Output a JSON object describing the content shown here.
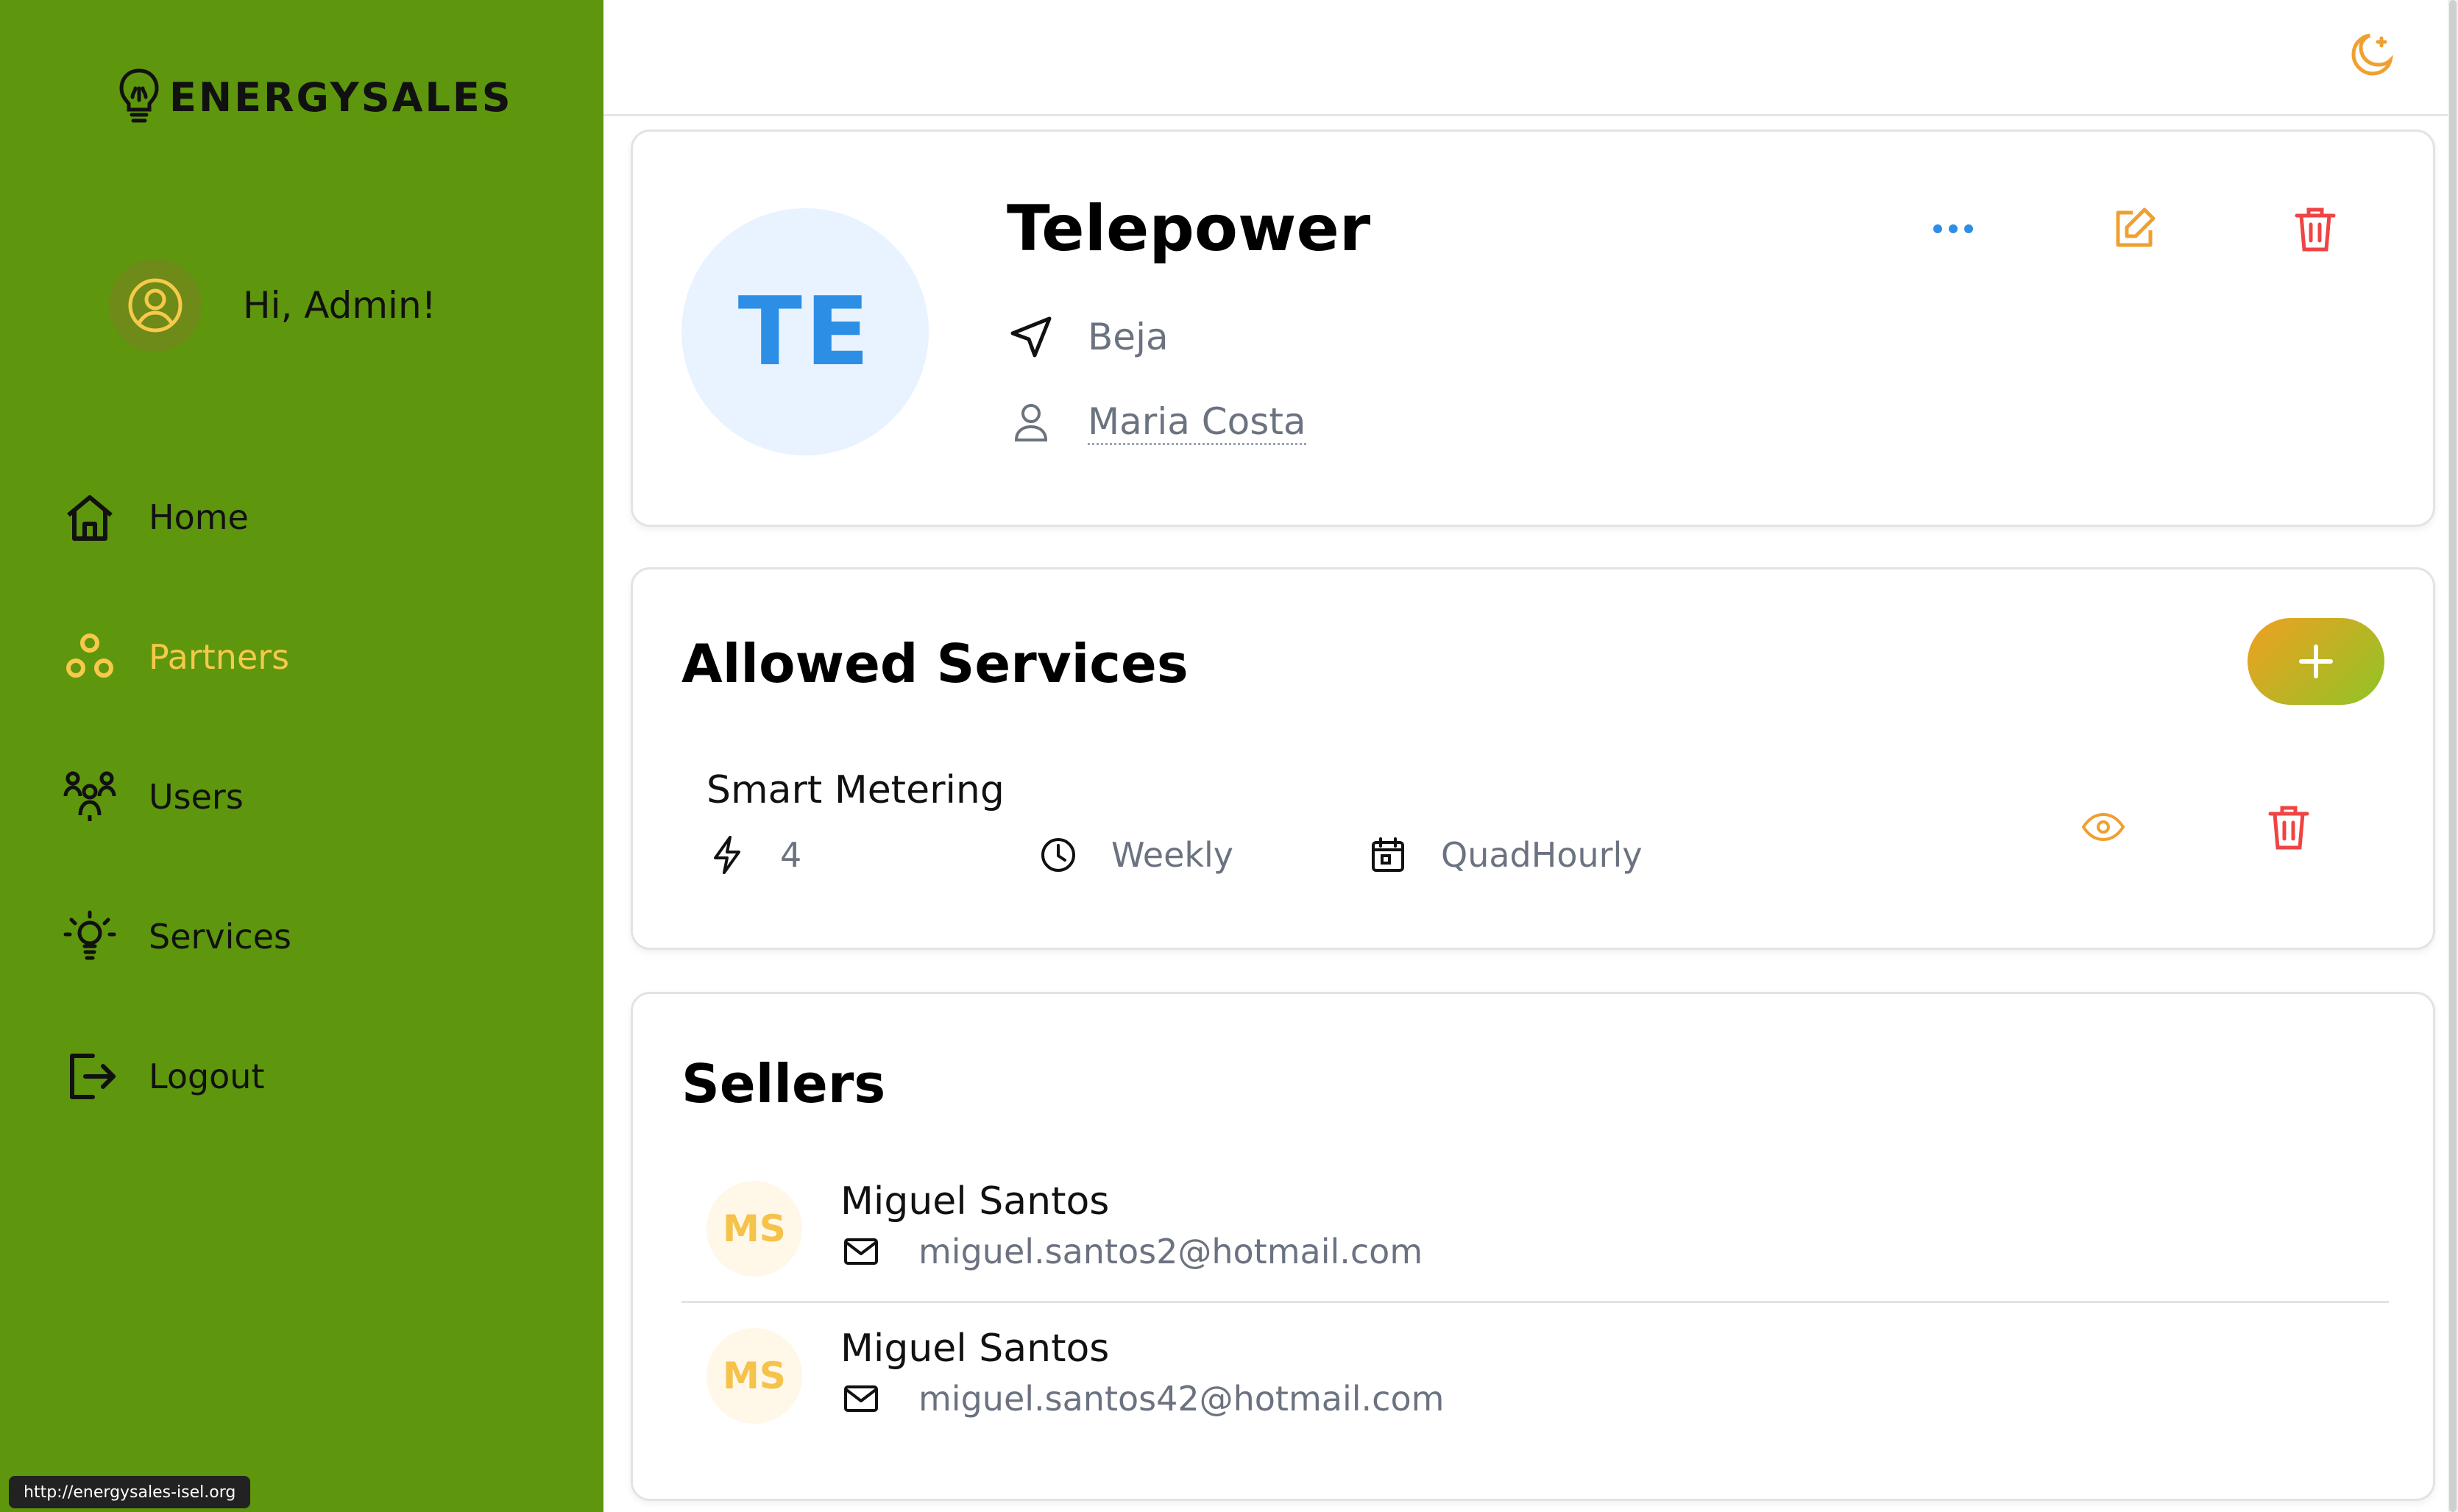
{
  "app": {
    "brand": "ENERGYSALES",
    "status_url": "http://energysales-isel.org"
  },
  "colors": {
    "sidebar_bg": "#5e960d",
    "active_nav": "#f7c94a",
    "accent_blue": "#2d8ee6",
    "edit_orange": "#f0a030",
    "delete_red": "#ef4444"
  },
  "sidebar": {
    "greeting": "Hi, Admin!",
    "items": [
      {
        "label": "Home",
        "icon": "home-icon",
        "active": false
      },
      {
        "label": "Partners",
        "icon": "partners-icon",
        "active": true
      },
      {
        "label": "Users",
        "icon": "users-icon",
        "active": false
      },
      {
        "label": "Services",
        "icon": "lightbulb-icon",
        "active": false
      },
      {
        "label": "Logout",
        "icon": "logout-icon",
        "active": false
      }
    ]
  },
  "topbar": {
    "theme_icon": "moon-icon"
  },
  "partner": {
    "initials": "TE",
    "name": "Telepower",
    "location": "Beja",
    "manager": "Maria Costa",
    "actions": [
      "more-icon",
      "edit-icon",
      "trash-icon"
    ]
  },
  "services": {
    "title": "Allowed Services",
    "items": [
      {
        "name": "Smart Metering",
        "power": "4",
        "frequency": "Weekly",
        "granularity": "QuadHourly"
      }
    ]
  },
  "sellers": {
    "title": "Sellers",
    "items": [
      {
        "initials": "MS",
        "name": "Miguel Santos",
        "email": "miguel.santos2@hotmail.com"
      },
      {
        "initials": "MS",
        "name": "Miguel Santos",
        "email": "miguel.santos42@hotmail.com"
      }
    ]
  }
}
